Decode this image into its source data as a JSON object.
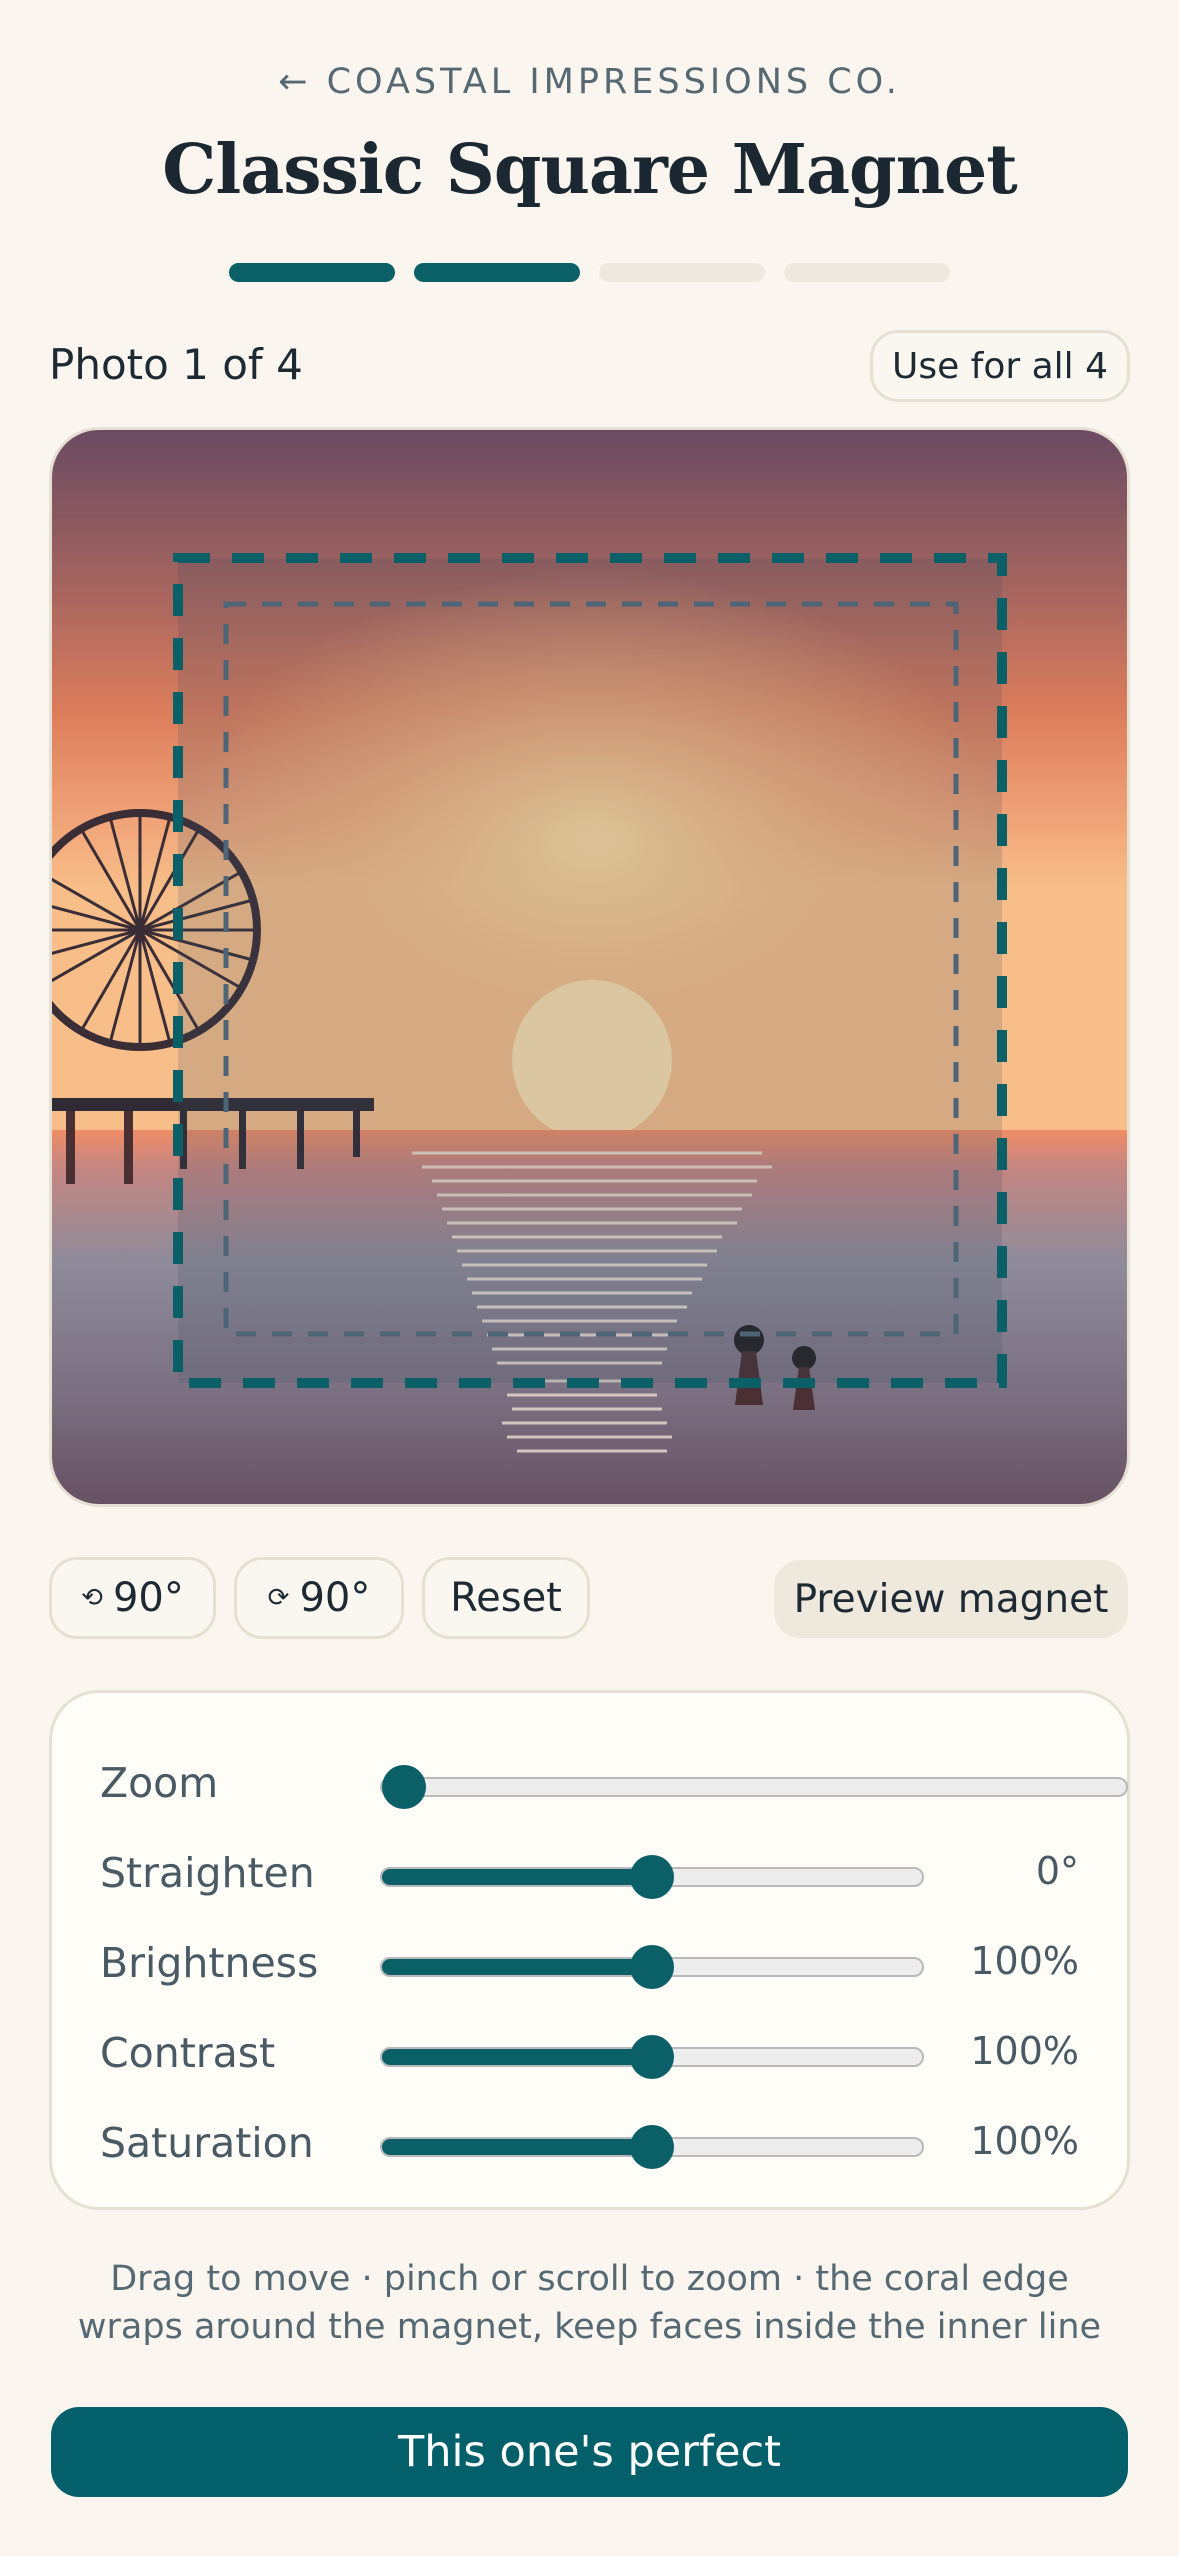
{
  "header": {
    "back_arrow": "←",
    "brand": "COASTAL IMPRESSIONS CO.",
    "title": "Classic Square Magnet"
  },
  "progress": {
    "total_steps": 4,
    "completed_steps": 2
  },
  "photo_nav": {
    "counter": "Photo 1 of 4",
    "use_all_label": "Use for all 4"
  },
  "actions": {
    "rotate_left_icon": "⟲",
    "rotate_left_label": "90°",
    "rotate_right_icon": "⟳",
    "rotate_right_label": "90°",
    "reset_label": "Reset",
    "preview_label": "Preview magnet"
  },
  "adjustments": {
    "zoom": {
      "label": "Zoom",
      "value": 0.0
    },
    "straighten": {
      "label": "Straighten",
      "value": 0.5,
      "display": "0°"
    },
    "brightness": {
      "label": "Brightness",
      "value": 0.5,
      "display": "100%"
    },
    "contrast": {
      "label": "Contrast",
      "value": 0.5,
      "display": "100%"
    },
    "saturation": {
      "label": "Saturation",
      "value": 0.5,
      "display": "100%"
    }
  },
  "hint": "Drag to move · pinch or scroll to zoom · the coral edge wraps around the magnet, keep faces inside the inner line",
  "cta_label": "This one's perfect",
  "colors": {
    "accent": "#0b5f67",
    "background": "#faf6ef",
    "button": "#03606a"
  },
  "icons": [
    "back-arrow-icon",
    "rotate-left-icon",
    "rotate-right-icon",
    "ferris-wheel",
    "sun",
    "pier"
  ]
}
